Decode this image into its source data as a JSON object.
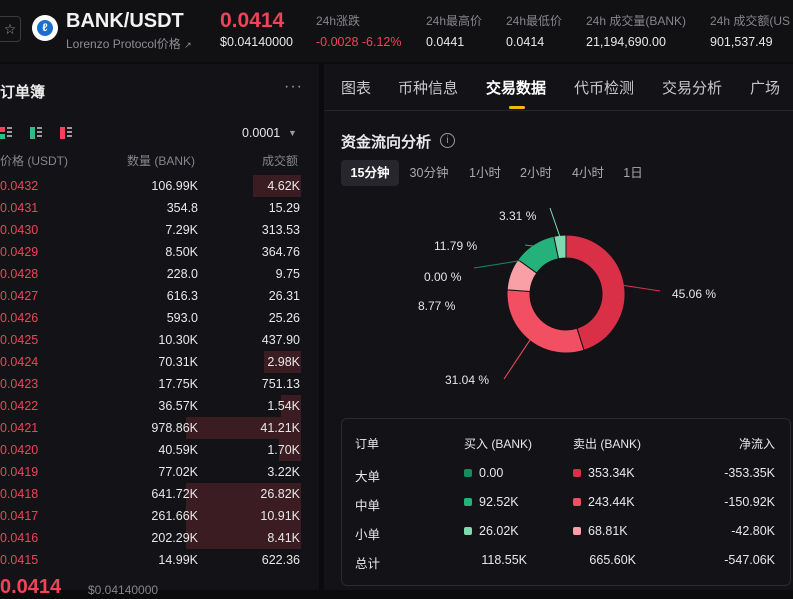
{
  "header": {
    "pair": "BANK/USDT",
    "subname": "Lorenzo Protocol价格",
    "price": "0.0414",
    "price_usd": "$0.04140000",
    "stats": [
      {
        "label": "24h涨跌",
        "value": "-0.0028 -6.12%"
      },
      {
        "label": "24h最高价",
        "value": "0.0441"
      },
      {
        "label": "24h最低价",
        "value": "0.0414"
      },
      {
        "label": "24h 成交量(BANK)",
        "value": "21,194,690.00"
      },
      {
        "label": "24h 成交额(US",
        "value": "901,537.49"
      }
    ]
  },
  "orderbook": {
    "title": "订单簿",
    "tick": "0.0001",
    "columns": {
      "price": "价格 (USDT)",
      "qty": "数量 (BANK)",
      "total": "成交额"
    },
    "rows": [
      {
        "price": "0.0432",
        "qty": "106.99K",
        "total": "4.62K",
        "depth": 0.42
      },
      {
        "price": "0.0431",
        "qty": "354.8",
        "total": "15.29",
        "depth": 0.0
      },
      {
        "price": "0.0430",
        "qty": "7.29K",
        "total": "313.53",
        "depth": 0.0
      },
      {
        "price": "0.0429",
        "qty": "8.50K",
        "total": "364.76",
        "depth": 0.0
      },
      {
        "price": "0.0428",
        "qty": "228.0",
        "total": "9.75",
        "depth": 0.0
      },
      {
        "price": "0.0427",
        "qty": "616.3",
        "total": "26.31",
        "depth": 0.0
      },
      {
        "price": "0.0426",
        "qty": "593.0",
        "total": "25.26",
        "depth": 0.0
      },
      {
        "price": "0.0425",
        "qty": "10.30K",
        "total": "437.90",
        "depth": 0.0
      },
      {
        "price": "0.0424",
        "qty": "70.31K",
        "total": "2.98K",
        "depth": 0.32
      },
      {
        "price": "0.0423",
        "qty": "17.75K",
        "total": "751.13",
        "depth": 0.0
      },
      {
        "price": "0.0422",
        "qty": "36.57K",
        "total": "1.54K",
        "depth": 0.17
      },
      {
        "price": "0.0421",
        "qty": "978.86K",
        "total": "41.21K",
        "depth": 1.0
      },
      {
        "price": "0.0420",
        "qty": "40.59K",
        "total": "1.70K",
        "depth": 0.19
      },
      {
        "price": "0.0419",
        "qty": "77.02K",
        "total": "3.22K",
        "depth": 0.0
      },
      {
        "price": "0.0418",
        "qty": "641.72K",
        "total": "26.82K",
        "depth": 1.0
      },
      {
        "price": "0.0417",
        "qty": "261.66K",
        "total": "10.91K",
        "depth": 1.0
      },
      {
        "price": "0.0416",
        "qty": "202.29K",
        "total": "8.41K",
        "depth": 1.0
      },
      {
        "price": "0.0415",
        "qty": "14.99K",
        "total": "622.36",
        "depth": 0.0
      }
    ],
    "last_price": "0.0414",
    "last_price_usd": "$0.04140000"
  },
  "tabs": [
    "图表",
    "币种信息",
    "交易数据",
    "代币检测",
    "交易分析",
    "广场"
  ],
  "active_tab": 2,
  "fund_flow": {
    "title": "资金流向分析",
    "periods": [
      "15分钟",
      "30分钟",
      "1小时",
      "2小时",
      "4小时",
      "1日"
    ],
    "active_period": 0
  },
  "chart_data": {
    "type": "pie",
    "donut": true,
    "slices": [
      {
        "label": "45.06 %",
        "value": 45.06,
        "color": "#da3047"
      },
      {
        "label": "31.04 %",
        "value": 31.04,
        "color": "#f24f62"
      },
      {
        "label": "8.77 %",
        "value": 8.77,
        "color": "#f8a0a6"
      },
      {
        "label": "0.00 %",
        "value": 0.0,
        "color": "#178a5e"
      },
      {
        "label": "11.79 %",
        "value": 11.79,
        "color": "#24b27a"
      },
      {
        "label": "3.31 %",
        "value": 3.31,
        "color": "#7fd9b0"
      }
    ]
  },
  "flow_table": {
    "headers": [
      "订单",
      "买入 (BANK)",
      "卖出 (BANK)",
      "净流入"
    ],
    "rows": [
      {
        "type": "大单",
        "buy": "0.00",
        "sell": "353.34K",
        "net": "-353.35K",
        "buy_color": "#178a5e",
        "sell_color": "#da3047"
      },
      {
        "type": "中单",
        "buy": "92.52K",
        "sell": "243.44K",
        "net": "-150.92K",
        "buy_color": "#24b27a",
        "sell_color": "#f24f62"
      },
      {
        "type": "小单",
        "buy": "26.02K",
        "sell": "68.81K",
        "net": "-42.80K",
        "buy_color": "#7fd9b0",
        "sell_color": "#f8a0a6"
      }
    ],
    "total": {
      "type": "总计",
      "buy": "118.55K",
      "sell": "665.60K",
      "net": "-547.06K"
    }
  }
}
